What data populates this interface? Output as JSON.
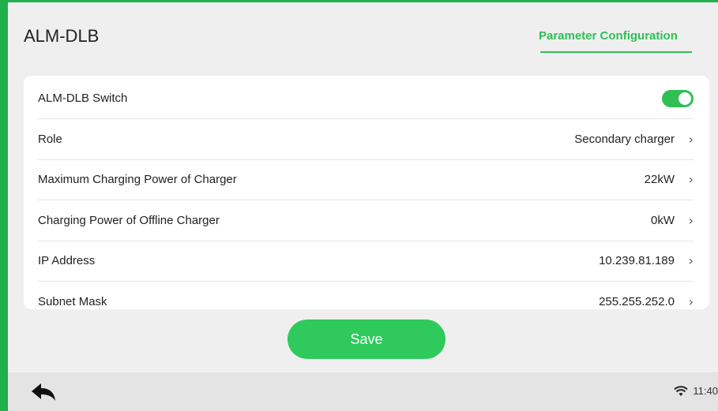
{
  "header": {
    "title": "ALM-DLB",
    "active_tab": "Parameter Configuration"
  },
  "settings": {
    "switch": {
      "label": "ALM-DLB Switch",
      "enabled": true
    },
    "rows": [
      {
        "label": "Role",
        "value": "Secondary charger"
      },
      {
        "label": "Maximum Charging Power of Charger",
        "value": "22kW"
      },
      {
        "label": "Charging Power of Offline Charger",
        "value": "0kW"
      },
      {
        "label": "IP Address",
        "value": "10.239.81.189"
      },
      {
        "label": "Subnet Mask",
        "value": "255.255.252.0"
      }
    ],
    "chevron": "›"
  },
  "actions": {
    "save_label": "Save"
  },
  "status_bar": {
    "time": "11:40",
    "wifi_icon": "wifi-icon",
    "back_icon": "back-icon"
  },
  "colors": {
    "accent": "#2fbf55",
    "button": "#2fca5b",
    "frame": "#21b04b"
  }
}
